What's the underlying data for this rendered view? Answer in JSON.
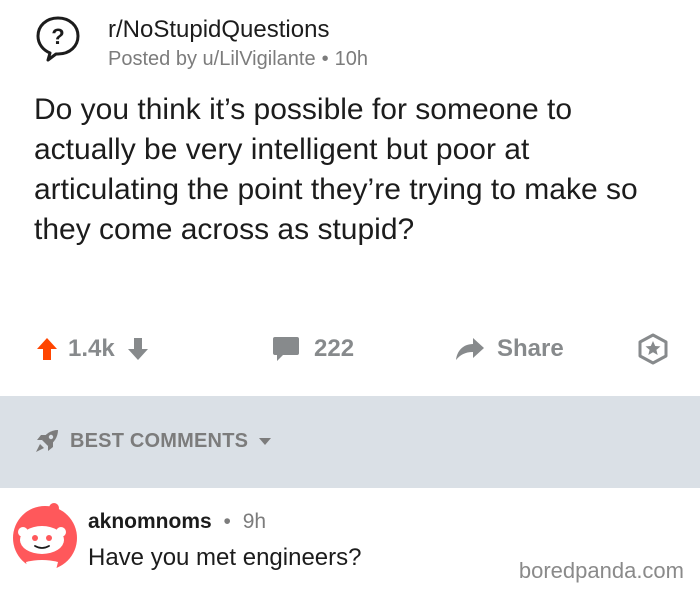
{
  "post": {
    "subreddit": "r/NoStupidQuestions",
    "posted_prefix": "Posted by",
    "author": "u/LilVigilante",
    "separator": "•",
    "age": "10h",
    "title": "Do you think it’s possible for someone to actually be very intelligent but poor at articulating the point they’re trying to make so they come across as stupid?"
  },
  "actions": {
    "upvotes": "1.4k",
    "comments": "222",
    "share": "Share"
  },
  "comments_section": {
    "sort_label": "BEST COMMENTS"
  },
  "comment": {
    "user": "aknomnoms",
    "separator": "•",
    "age": "9h",
    "body": "Have you met engineers?"
  },
  "watermark": "boredpanda.com",
  "colors": {
    "upvote": "#ff4500",
    "icon_gray": "#878a8c",
    "band": "#dae0e6",
    "avatar": "#ff585b"
  },
  "icons": {
    "subreddit": "question-mark-bubble-icon",
    "upvote": "arrow-up-icon",
    "downvote": "arrow-down-icon",
    "comment": "speech-bubble-icon",
    "share": "share-arrow-icon",
    "award": "award-icon",
    "sort": "rocket-icon",
    "sort_menu": "chevron-down-icon",
    "avatar": "snoo-avatar-icon"
  }
}
